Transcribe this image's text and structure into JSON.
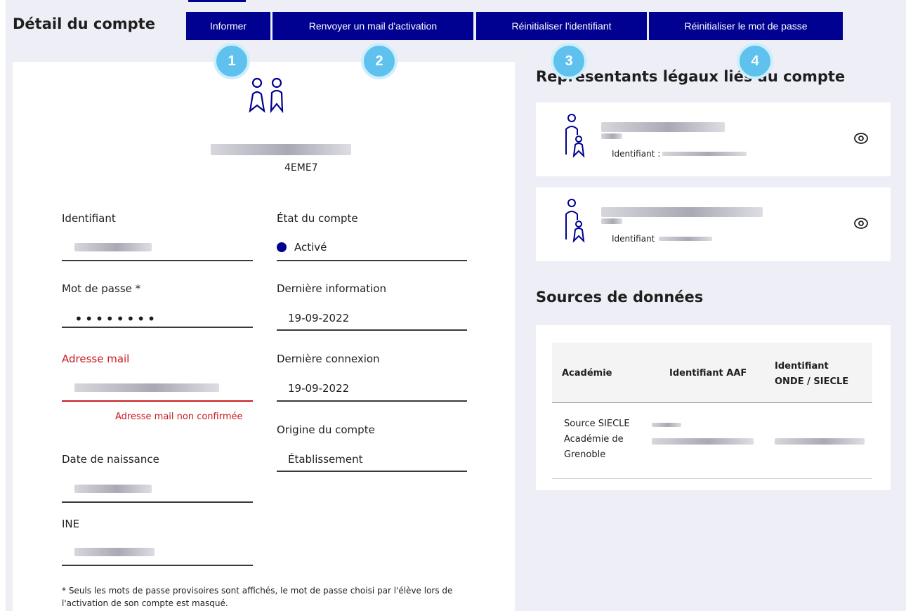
{
  "header": {
    "title": "Détail du compte",
    "buttons": [
      {
        "label": "Informer"
      },
      {
        "label": "Renvoyer un mail d'activation"
      },
      {
        "label": "Réinitialiser l'identifiant"
      },
      {
        "label": "Réinitialiser le mot de passe"
      }
    ],
    "badges": [
      "1",
      "2",
      "3",
      "4"
    ]
  },
  "student": {
    "icon": "students-icon",
    "class": "4EME7"
  },
  "fields": {
    "identifiant": {
      "label": "Identifiant"
    },
    "etat": {
      "label": "État du compte",
      "value": "Activé",
      "dot_color": "#000091"
    },
    "mot_de_passe": {
      "label": "Mot de passe *",
      "value": "••••••••"
    },
    "derniere_information": {
      "label": "Dernière information",
      "value": "19-09-2022"
    },
    "adresse_mail": {
      "label": "Adresse mail",
      "error": "Adresse mail non confirmée"
    },
    "derniere_connexion": {
      "label": "Dernière connexion",
      "value": "19-09-2022"
    },
    "origine": {
      "label": "Origine du compte",
      "value": "Établissement"
    },
    "date_naissance": {
      "label": "Date de naissance"
    },
    "ine": {
      "label": "INE"
    }
  },
  "footnote": "* Seuls les mots de passe provisoires sont affichés, le mot de passe choisi par l'élève lors de l'activation de son compte est masqué.",
  "representatives": {
    "title": "Représentants légaux liés au compte",
    "items": [
      {
        "id_label": "Identifiant :",
        "icon": "parent-icon",
        "action_icon": "eye-icon"
      },
      {
        "id_label": "Identifiant",
        "icon": "parent-icon",
        "action_icon": "eye-icon"
      }
    ]
  },
  "sources": {
    "title": "Sources de données",
    "columns": [
      "Académie",
      "Identifiant AAF",
      "Identifiant ONDE / SIECLE"
    ],
    "row": {
      "academie": "Source SIECLE Académie de Grenoble"
    }
  },
  "colors": {
    "primary": "#000091",
    "badge": "#5fc1ee",
    "error": "#c9191e",
    "background": "#eeeef7"
  }
}
